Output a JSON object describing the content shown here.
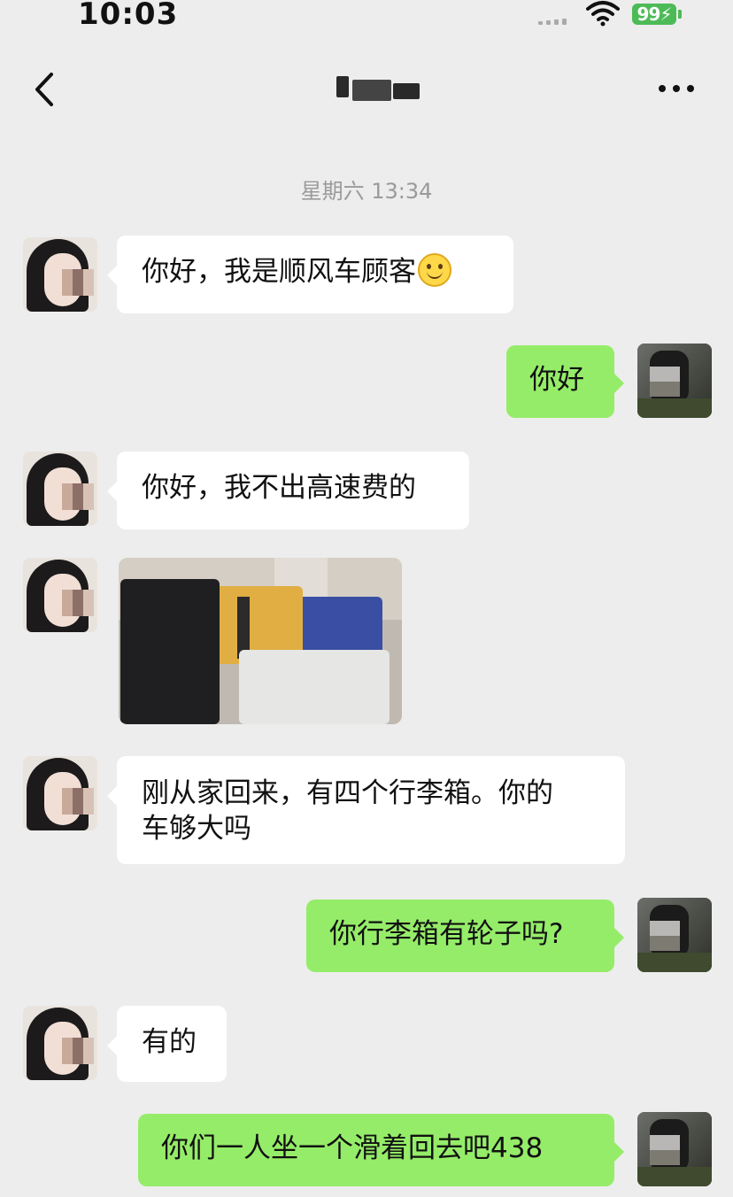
{
  "status_bar": {
    "time": "10:03",
    "battery": "99"
  },
  "header": {
    "back_icon": "chevron-left-icon",
    "more_icon": "more-dots-icon"
  },
  "timestamp": "星期六 13:34",
  "messages": [
    {
      "from": "other",
      "text": "你好，我是顺风车顾客",
      "emoji": "smile-emoji"
    },
    {
      "from": "me",
      "text": "你好"
    },
    {
      "from": "other",
      "text": "你好，我不出高速费的"
    },
    {
      "from": "other",
      "type": "image",
      "image": "luggage-photo"
    },
    {
      "from": "other",
      "lines": [
        "刚从家回来，有四个行李箱。你的",
        "车够大吗"
      ]
    },
    {
      "from": "me",
      "text": "你行李箱有轮子吗?"
    },
    {
      "from": "other",
      "text": "有的"
    },
    {
      "from": "me",
      "text": "你们一人坐一个滑着回去吧438"
    }
  ],
  "colors": {
    "incoming_bubble": "#ffffff",
    "outgoing_bubble": "#95ec69",
    "background": "#ededed",
    "battery": "#4cbb57"
  }
}
